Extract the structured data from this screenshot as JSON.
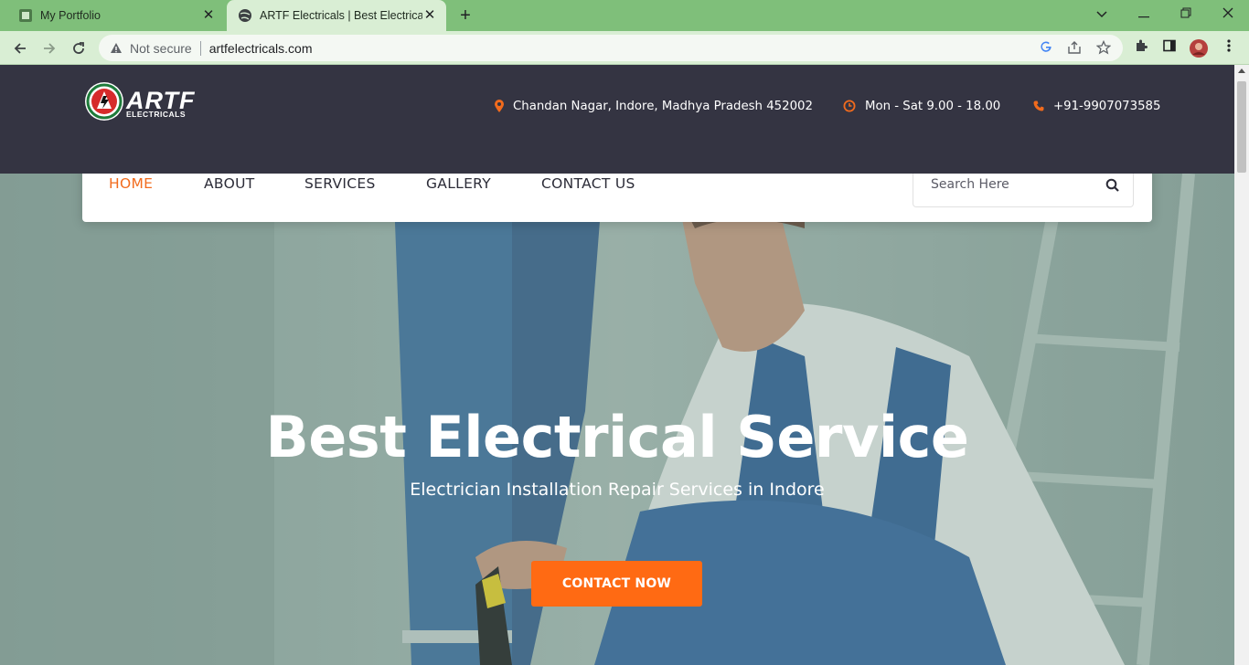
{
  "browser": {
    "tabs": [
      {
        "title": "My Portfolio",
        "active": false
      },
      {
        "title": "ARTF Electricals | Best Electrican I",
        "active": true
      }
    ],
    "address": {
      "security_label": "Not secure",
      "url": "artfelectricals.com"
    },
    "colors": {
      "frame": "#7fbf7a",
      "toolbar": "#d9eed4"
    }
  },
  "site": {
    "logo": {
      "name": "ARTF",
      "sub": "ELECTRICALS"
    },
    "contact": {
      "address": "Chandan Nagar, Indore, Madhya Pradesh 452002",
      "hours": "Mon - Sat 9.00 - 18.00",
      "phone": "+91-9907073585"
    },
    "nav": [
      {
        "label": "HOME",
        "active": true
      },
      {
        "label": "ABOUT",
        "active": false
      },
      {
        "label": "SERVICES",
        "active": false
      },
      {
        "label": "GALLERY",
        "active": false
      },
      {
        "label": "CONTACT US",
        "active": false
      }
    ],
    "search": {
      "placeholder": "Search Here"
    },
    "hero": {
      "title": "Best Electrical Service",
      "subtitle": "Electrician Installation Repair Services in Indore",
      "cta": "CONTACT NOW"
    },
    "colors": {
      "accent": "#ff6a13",
      "header": "#343442"
    }
  }
}
